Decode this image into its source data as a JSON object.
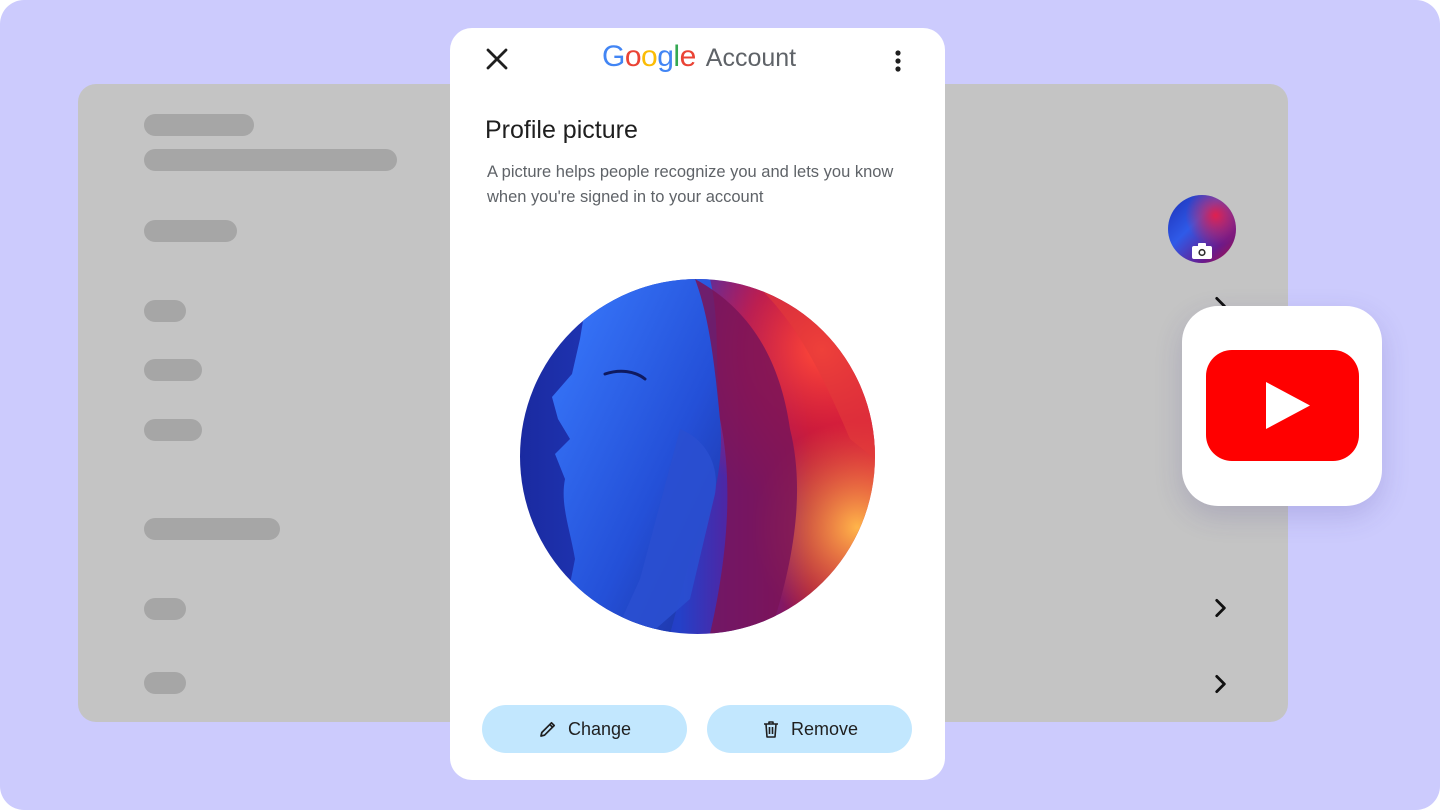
{
  "dialog": {
    "brand_google": "Google",
    "brand_account": "Account",
    "title": "Profile picture",
    "description": "A picture helps people recognize you and lets you know when you're signed in to your account",
    "change_label": "Change",
    "remove_label": "Remove"
  },
  "icons": {
    "close": "close-icon",
    "more": "more-vert-icon",
    "change": "pencil-icon",
    "remove": "trash-icon",
    "camera": "camera-icon",
    "chevron": "chevron-right-icon",
    "youtube": "youtube-logo"
  },
  "colors": {
    "backdrop": "#cccbfd",
    "panel": "#c4c4c4",
    "placeholder": "#a6a6a6",
    "button": "#c2e7fe",
    "youtube_red": "#ff0000",
    "google_blue": "#4285f4",
    "google_red": "#ea4335",
    "google_yellow": "#fbbc05",
    "google_green": "#34a853"
  }
}
